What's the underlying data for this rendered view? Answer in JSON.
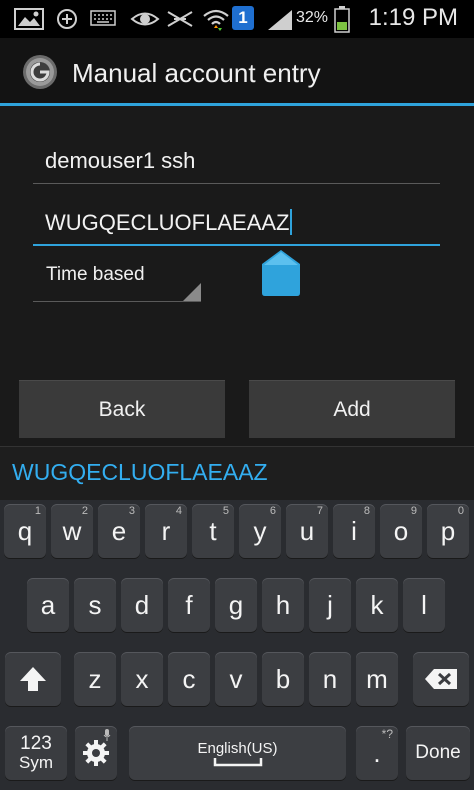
{
  "status_bar": {
    "battery_percent": "32%",
    "time": "1:19 PM",
    "notification_count": "1"
  },
  "action_bar": {
    "title": "Manual account entry"
  },
  "form": {
    "account_name_value": "demouser1 ssh",
    "key_value": "WUGQECLUOFLAEAAZ",
    "type_selected": "Time based"
  },
  "buttons": {
    "back_label": "Back",
    "add_label": "Add"
  },
  "suggestion": {
    "word": "WUGQECLUOFLAEAAZ"
  },
  "keyboard": {
    "row1": [
      {
        "key": "q",
        "num": "1"
      },
      {
        "key": "w",
        "num": "2"
      },
      {
        "key": "e",
        "num": "3"
      },
      {
        "key": "r",
        "num": "4"
      },
      {
        "key": "t",
        "num": "5"
      },
      {
        "key": "y",
        "num": "6"
      },
      {
        "key": "u",
        "num": "7"
      },
      {
        "key": "i",
        "num": "8"
      },
      {
        "key": "o",
        "num": "9"
      },
      {
        "key": "p",
        "num": "0"
      }
    ],
    "row2": [
      "a",
      "s",
      "d",
      "f",
      "g",
      "h",
      "j",
      "k",
      "l"
    ],
    "row3": [
      "z",
      "x",
      "c",
      "v",
      "b",
      "n",
      "m"
    ],
    "sym_label_top": "123",
    "sym_label_bottom": "Sym",
    "space_label": "English(US)",
    "period_label": ".",
    "period_secondary": "*?",
    "done_label": "Done",
    "icons": {
      "shift": "shift-arrow-icon",
      "backspace": "backspace-icon",
      "settings": "gear-icon"
    }
  },
  "colors": {
    "accent": "#2fa3dc",
    "suggestion_text": "#33aef0"
  }
}
